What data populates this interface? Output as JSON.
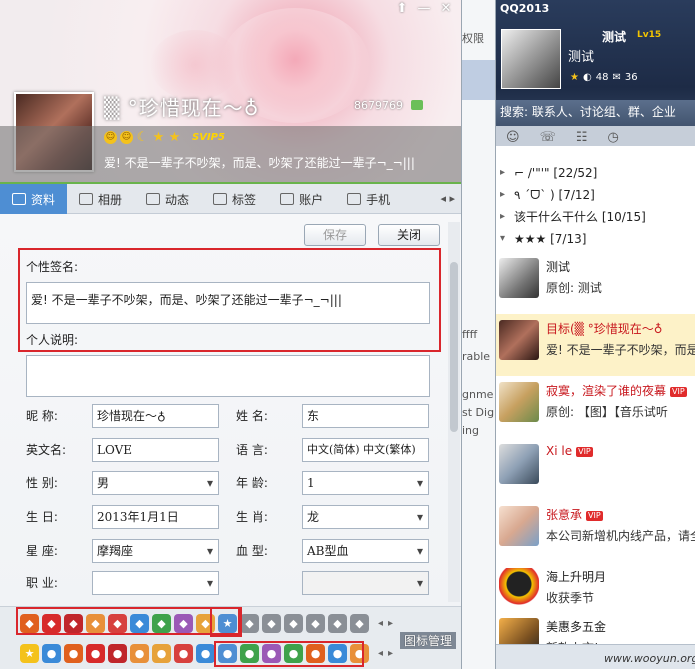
{
  "profile": {
    "nickname": "▒ °珍惜现在〜♁",
    "qq_number": "8679769",
    "svip": "SVIP5",
    "signature": "爱! 不是一辈子不吵架，而是、吵架了还能过一辈子¬_¬|||",
    "window_controls": [
      "⬆",
      "—",
      "✕"
    ],
    "tabs": [
      {
        "label": "资料"
      },
      {
        "label": "相册"
      },
      {
        "label": "动态"
      },
      {
        "label": "标签"
      },
      {
        "label": "账户"
      },
      {
        "label": "手机"
      }
    ],
    "tab_more": "◂ ▸",
    "save_label": "保存",
    "close_label": "关闭",
    "signature_label": "个性签名:",
    "signature_value": "爱! 不是一辈子不吵架，而是、吵架了还能过一辈子¬_¬|||",
    "description_label": "个人说明:",
    "description_value": "",
    "fields": {
      "nickname_label": "昵    称:",
      "nickname_value": "珍惜现在〜♁",
      "name_label": "姓    名:",
      "name_value": "东",
      "english_name_label": "英文名:",
      "english_name_value": "LOVE",
      "language_label": "语    言:",
      "language_value": "中文(简体) 中文(繁体)",
      "gender_label": "性    别:",
      "gender_value": "男",
      "age_label": "年    龄:",
      "age_value": "1",
      "birthday_label": "生    日:",
      "birthday_value": "2013年1月1日",
      "zodiac_label": "生    肖:",
      "zodiac_value": "龙",
      "constellation_label": "星    座:",
      "constellation_value": "摩羯座",
      "blood_label": "血    型:",
      "blood_value": "AB型血",
      "job_label": "职    业:",
      "job_value": ""
    },
    "icon_manage_label": "图标管理"
  },
  "middle": {
    "texts": [
      "权限",
      "ffff",
      "rable",
      "gnme",
      "st Dig",
      "ing"
    ]
  },
  "qq": {
    "title": "QQ2013",
    "name": "测试",
    "level": "Lv15",
    "stats": [
      "48",
      "36"
    ],
    "search_placeholder": "搜索: 联系人、讨论组、群、企业",
    "groups": [
      {
        "label": "⌐ /'\"'\"  [22/52]",
        "open": false
      },
      {
        "label": "٩ ˊᗜˋ )  [7/12]",
        "open": false
      },
      {
        "label": "该干什么干什么  [10/15]",
        "open": false
      },
      {
        "label": "★★★  [7/13]",
        "open": true
      }
    ],
    "contacts": [
      {
        "name": "测试",
        "status": "原创: 测试",
        "red": false,
        "vip": false
      },
      {
        "name": "目标(▒ °珍惜现在〜♁",
        "status": "爱! 不是一辈子不吵架，而是",
        "red": true,
        "vip": false
      },
      {
        "name": "寂寞，渲染了谁的夜幕",
        "status": "原创: 【图】【音乐试听",
        "red": true,
        "vip": true
      },
      {
        "name": "Xi le",
        "status": "",
        "red": true,
        "vip": true
      },
      {
        "name": "张意承",
        "status": "本公司新增机内线产品，请全",
        "red": true,
        "vip": true
      },
      {
        "name": "海上升明月",
        "status": "收获季节",
        "red": false,
        "vip": false
      },
      {
        "name": "美惠多五金",
        "status": "新款上市!",
        "red": false,
        "vip": false
      }
    ],
    "vip_badge": "VIP",
    "watermark": "www.wooyun.org"
  }
}
